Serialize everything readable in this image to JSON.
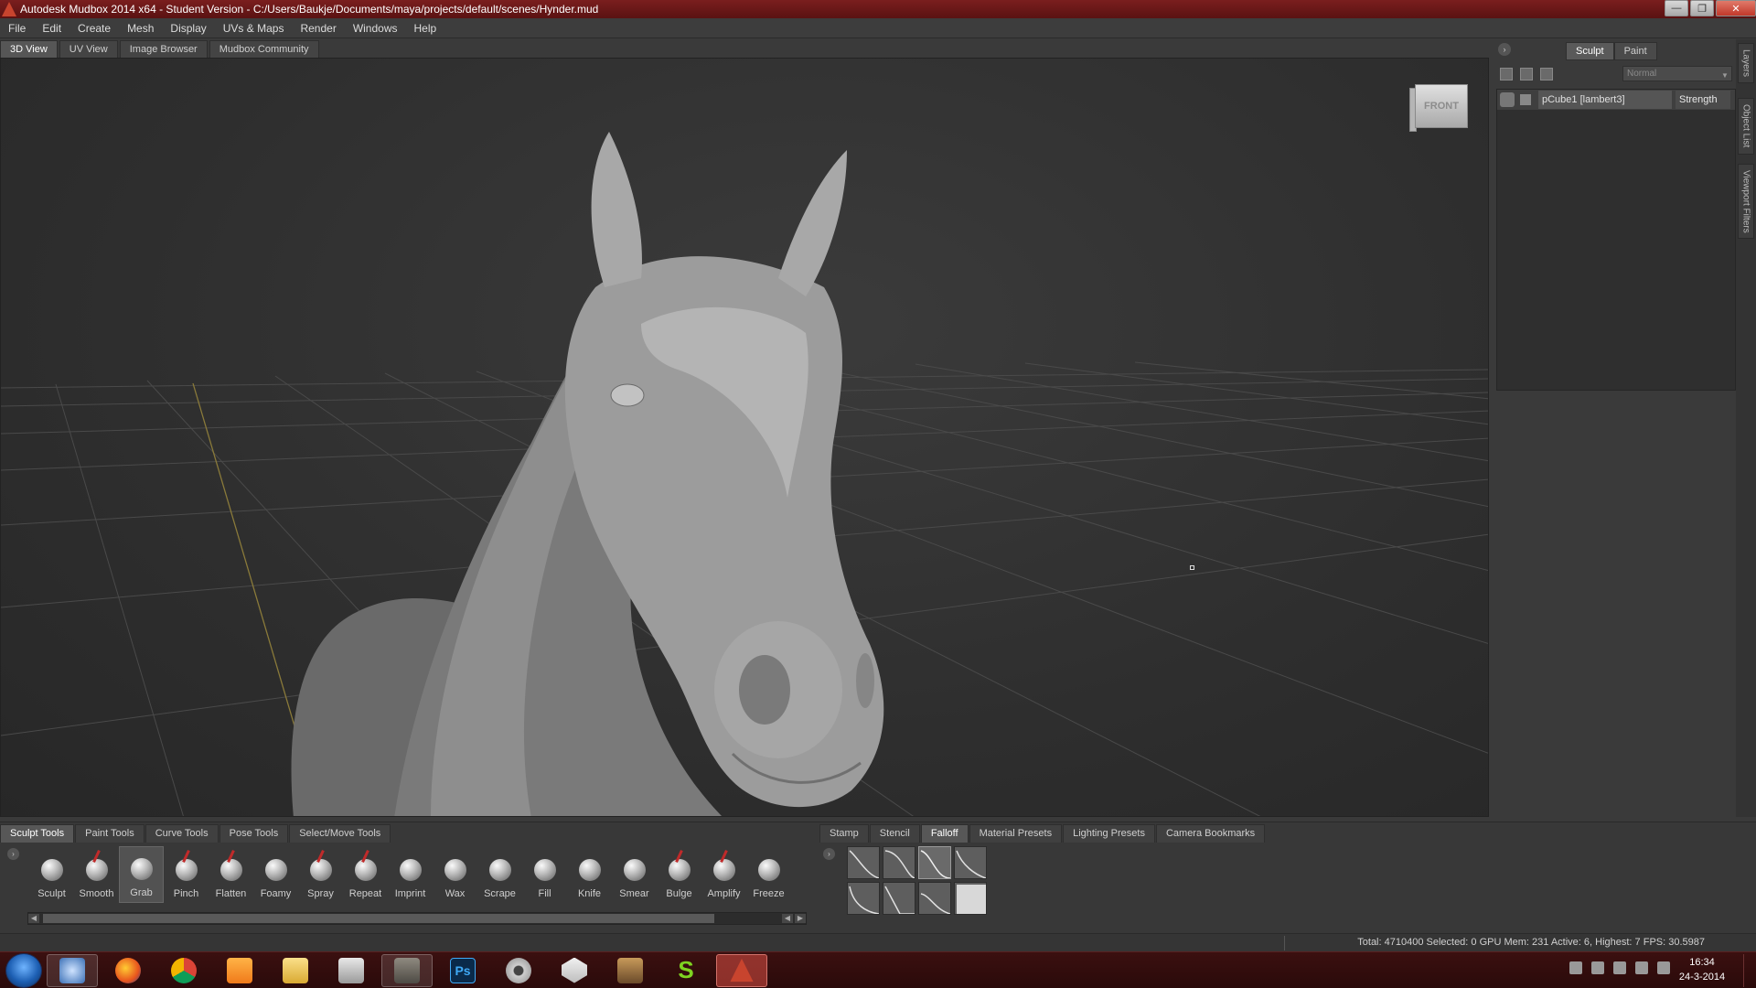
{
  "window": {
    "title": "Autodesk Mudbox 2014 x64 - Student Version - C:/Users/Baukje/Documents/maya/projects/default/scenes/Hynder.mud",
    "min_glyph": "—",
    "max_glyph": "❐",
    "close_glyph": "✕"
  },
  "menu": [
    "File",
    "Edit",
    "Create",
    "Mesh",
    "Display",
    "UVs & Maps",
    "Render",
    "Windows",
    "Help"
  ],
  "view_tabs": [
    "3D View",
    "UV View",
    "Image Browser",
    "Mudbox Community"
  ],
  "viewport": {
    "viewcube_label": "FRONT",
    "background": "#2e2e2e",
    "model": "horse-head-sculpt"
  },
  "right_panel": {
    "arrow_glyph": "›",
    "tabs": [
      "Sculpt",
      "Paint"
    ],
    "blend_mode": "Normal",
    "layer": {
      "name": "pCube1 [lambert3]",
      "strength": "Strength"
    },
    "side_tabs": [
      "Layers",
      "Object List",
      "Viewport Filters"
    ]
  },
  "tool_tabs": [
    "Sculpt Tools",
    "Paint Tools",
    "Curve Tools",
    "Pose Tools",
    "Select/Move Tools"
  ],
  "tools": [
    {
      "label": "Sculpt",
      "red": false
    },
    {
      "label": "Smooth",
      "red": true
    },
    {
      "label": "Grab",
      "red": false
    },
    {
      "label": "Pinch",
      "red": true
    },
    {
      "label": "Flatten",
      "red": true
    },
    {
      "label": "Foamy",
      "red": false
    },
    {
      "label": "Spray",
      "red": true
    },
    {
      "label": "Repeat",
      "red": true
    },
    {
      "label": "Imprint",
      "red": false
    },
    {
      "label": "Wax",
      "red": false
    },
    {
      "label": "Scrape",
      "red": false
    },
    {
      "label": "Fill",
      "red": false
    },
    {
      "label": "Knife",
      "red": false
    },
    {
      "label": "Smear",
      "red": false
    },
    {
      "label": "Bulge",
      "red": true
    },
    {
      "label": "Amplify",
      "red": true
    },
    {
      "label": "Freeze",
      "red": false
    }
  ],
  "active_tool": "Grab",
  "props_tabs": [
    "Stamp",
    "Stencil",
    "Falloff",
    "Material Presets",
    "Lighting Presets",
    "Camera Bookmarks"
  ],
  "active_props_tab": "Falloff",
  "status": "Total: 4710400  Selected: 0 GPU Mem: 231  Active: 6, Highest: 7  FPS: 30.5987",
  "taskbar": {
    "apps": [
      "start-orb",
      "network",
      "firefox",
      "chrome",
      "media-player",
      "file-explorer",
      "window-manager",
      "gimp",
      "photoshop",
      "settings",
      "unity",
      "moose",
      "skype-like-s",
      "mudbox"
    ],
    "ps_label": "Ps",
    "s_label": "S",
    "time": "16:34",
    "date": "24-3-2014"
  }
}
